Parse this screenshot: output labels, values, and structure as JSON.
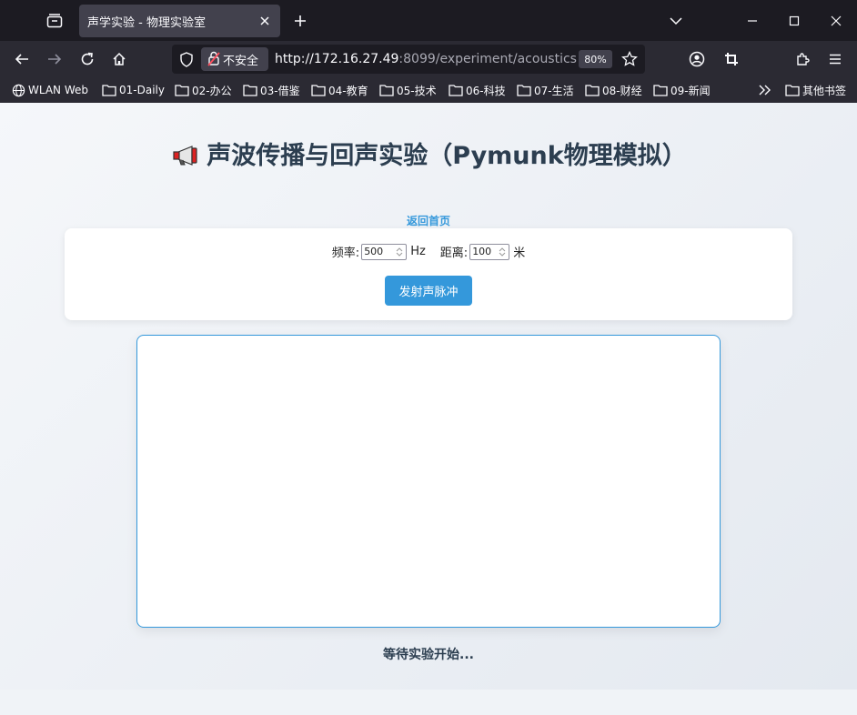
{
  "browser": {
    "tab_title": "声学实验 - 物理实验室",
    "security_label": "不安全",
    "url_host": "http://172.16.27.49",
    "url_rest": ":8099/experiment/acoustics",
    "zoom": "80%"
  },
  "bookmarks": [
    {
      "label": "WLAN Web",
      "icon": "globe-icon"
    },
    {
      "label": "01-Daily",
      "icon": "folder-icon"
    },
    {
      "label": "02-办公",
      "icon": "folder-icon"
    },
    {
      "label": "03-借鉴",
      "icon": "folder-icon"
    },
    {
      "label": "04-教育",
      "icon": "folder-icon"
    },
    {
      "label": "05-技术",
      "icon": "folder-icon"
    },
    {
      "label": "06-科技",
      "icon": "folder-icon"
    },
    {
      "label": "07-生活",
      "icon": "folder-icon"
    },
    {
      "label": "08-财经",
      "icon": "folder-icon"
    },
    {
      "label": "09-新闻",
      "icon": "folder-icon"
    }
  ],
  "other_bookmarks": "其他书签",
  "page": {
    "title": "声波传播与回声实验（Pymunk物理模拟）",
    "home_link": "返回首页",
    "frequency_label": "频率:",
    "frequency_value": "500",
    "frequency_unit": "Hz",
    "distance_label": "距离:",
    "distance_value": "100",
    "distance_unit": "米",
    "pulse_button": "发射声脉冲",
    "status": "等待实验开始..."
  },
  "colors": {
    "accent": "#3498db",
    "title": "#2c3e50"
  }
}
